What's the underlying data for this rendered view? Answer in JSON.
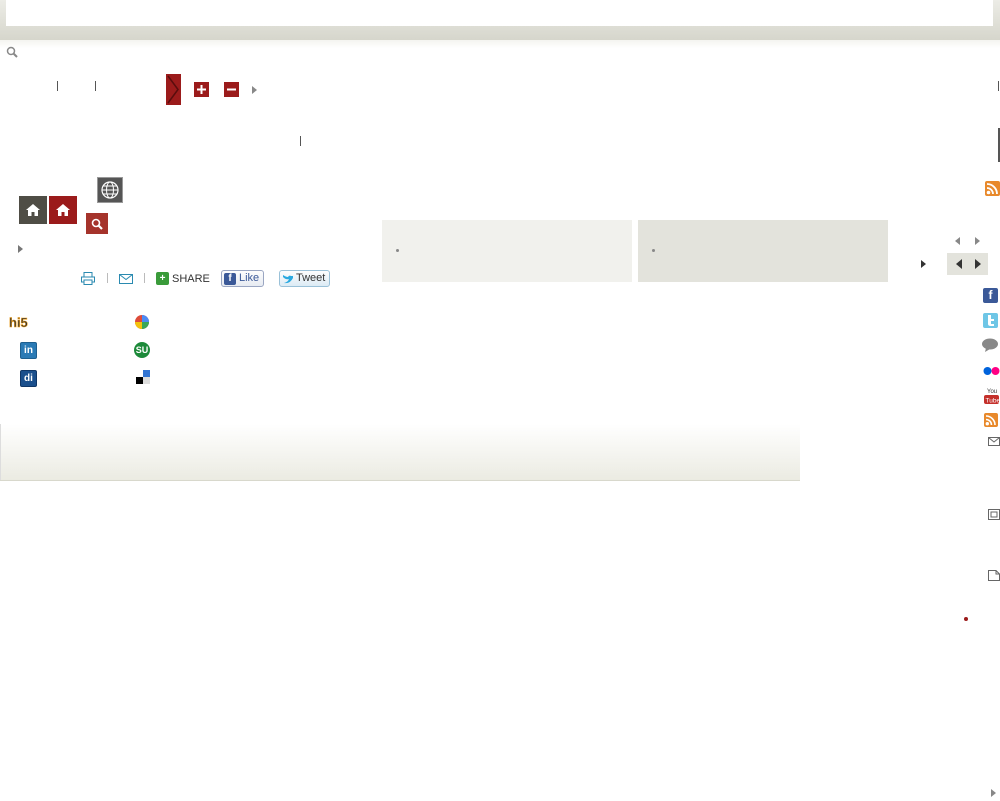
{
  "share": {
    "share_label": "SHARE",
    "like_label": "Like",
    "tweet_label": "Tweet"
  },
  "social_left": {
    "hi5_label": "hi5",
    "stumble_label": "SU",
    "linkedin_label": "in",
    "digg_label": "di"
  },
  "colors": {
    "accent_red": "#9b1b1b",
    "home_gray": "#4f4d45",
    "panel_light": "#f1f1ed",
    "panel_dark": "#e3e3dc",
    "rss_orange": "#e8892b"
  },
  "icons": [
    "search-icon",
    "zoom-in-icon",
    "zoom-out-icon",
    "home-icon",
    "globe-icon",
    "print-icon",
    "email-icon",
    "share-plus-icon",
    "facebook-icon",
    "twitter-icon",
    "comment-icon",
    "flickr-icon",
    "youtube-icon",
    "rss-icon",
    "window-icon",
    "document-icon"
  ]
}
